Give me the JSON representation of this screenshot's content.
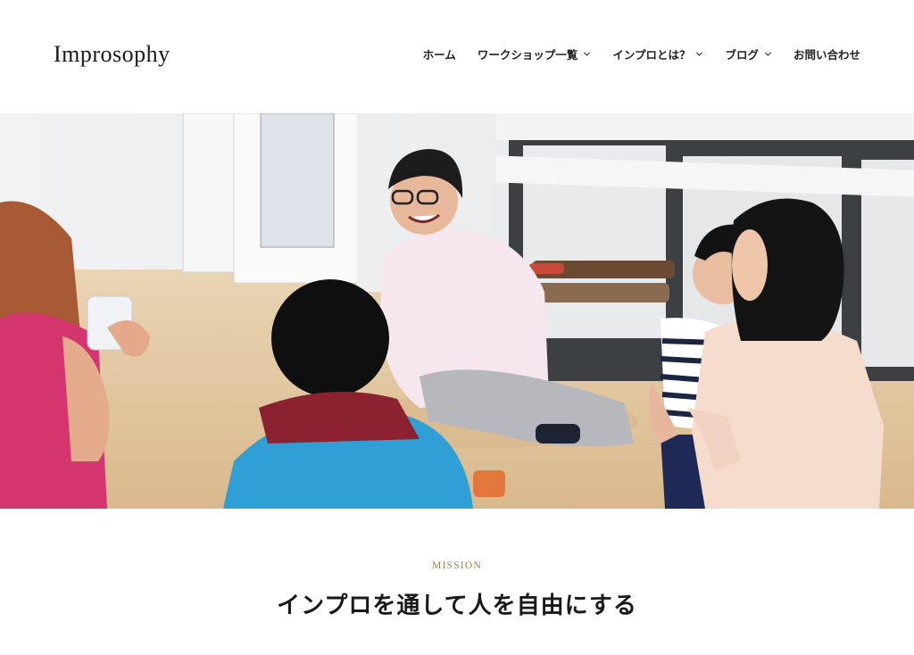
{
  "site": {
    "logo_text": "Improsophy"
  },
  "nav": {
    "items": [
      {
        "label": "ホーム",
        "has_dropdown": false
      },
      {
        "label": "ワークショップ一覧",
        "has_dropdown": true
      },
      {
        "label": "インプロとは？",
        "has_dropdown": true
      },
      {
        "label": "ブログ",
        "has_dropdown": true
      },
      {
        "label": "お問い合わせ",
        "has_dropdown": false
      }
    ]
  },
  "hero": {
    "icon": "photo"
  },
  "mission": {
    "label": "MISSION",
    "title": "インプロを通して人を自由にする"
  },
  "colors": {
    "accent": "#9a7d52",
    "text": "#1a1a1a"
  }
}
